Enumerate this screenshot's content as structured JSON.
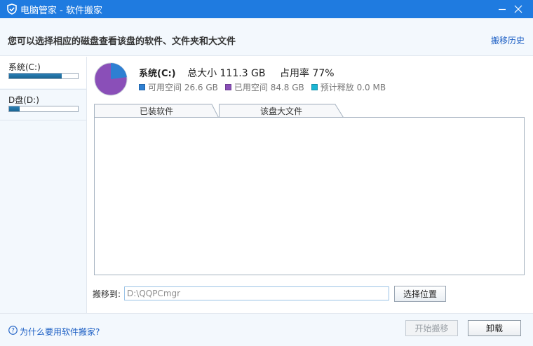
{
  "window": {
    "title": "电脑管家 - 软件搬家",
    "logo_icon": "shield-icon",
    "minimize_icon": "minimize-icon",
    "close_icon": "close-icon",
    "accent_color": "#1f7be0"
  },
  "header": {
    "headline": "您可以选择相应的磁盘查看该盘的软件、文件夹和大文件",
    "history_link": "搬移历史"
  },
  "drives": [
    {
      "label": "系统(C:)",
      "usage_fraction": 0.77,
      "selected": true
    },
    {
      "label": "D盘(D:)",
      "usage_fraction": 0.15,
      "selected": false
    }
  ],
  "summary": {
    "name": "系统(C:)",
    "total": "总大小 111.3 GB",
    "usage": "占用率 77%",
    "used_fraction": 0.77
  },
  "legend": [
    {
      "label": "可用空间 26.6 GB",
      "color": "#2e7fd2"
    },
    {
      "label": "已用空间 84.8 GB",
      "color": "#8a4fb8"
    },
    {
      "label": "预计释放 0.0 MB",
      "color": "#1ab6d4"
    }
  ],
  "tabs": [
    {
      "label": "已装软件"
    },
    {
      "label": "该盘大文件"
    }
  ],
  "move": {
    "label": "搬移到:",
    "path_value": "D:\\QQPCmgr",
    "choose_button": "选择位置"
  },
  "footer": {
    "help_icon": "help-circle-icon",
    "help_link": "为什么要用软件搬家?",
    "start_button": "开始搬移",
    "uninstall_button": "卸载"
  }
}
